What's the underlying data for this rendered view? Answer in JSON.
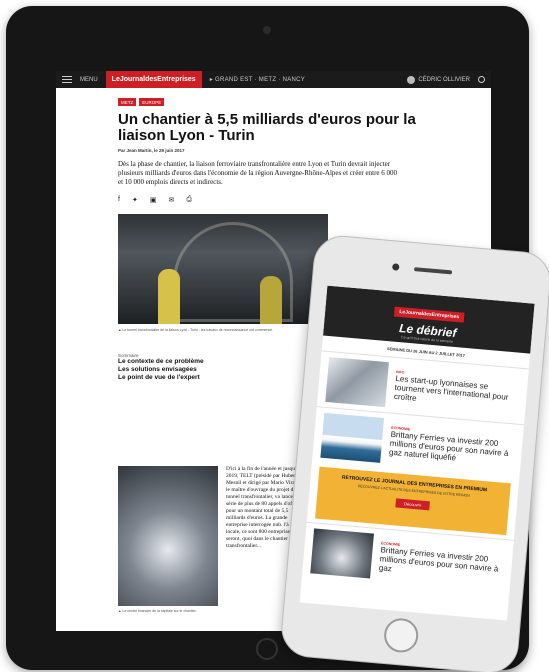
{
  "tablet": {
    "nav": {
      "menu_label": "MENU",
      "logo": "LeJournaldesEntreprises",
      "region": "▸ GRAND EST · METZ · NANCY",
      "user": "CÉDRIC OLLIVIER"
    },
    "article": {
      "tags": [
        "METZ",
        "EUROPE"
      ],
      "title": "Un chantier à 5,5 milliards d'euros pour la liaison Lyon - Turin",
      "byline": "Par Jean Martin, le 29 juin 2017",
      "lead": "Dès la phase de chantier, la liaison ferroviaire transfrontalière entre Lyon et Turin devrait injecter plusieurs milliards d'euros dans l'économie de la région Auvergne-Rhône-Alpes et créer entre 6 000 et 10 000 emplois directs et indirects.",
      "photo_caption": "▲ Le tunnel transfrontalier de la liaison Lyon - Turin : les travaux de reconnaissance ont commencé.",
      "summary_label": "Sommaire",
      "summary": [
        "Le contexte de ce problème",
        "Les solutions envisagées",
        "Le point de vue de l'expert"
      ],
      "photo2_caption": "▲ Le centre financier de la capitale sur le chantier.",
      "body_text": "D'ici à la fin de l'année et jusqu'en 2019, TELT (présidé par Hubert Du Mesnil et dirigé par Mario Virano), le maître d'ouvrage du projet de tunnel transfrontalier, va lancer une série de plus de 80 appels d'offres pour un montant total de 5,5 milliards d'euros. La grande entreprise interrogée nub. l'à PME locale, ce sont 800 entreprises qui seront, quoi dans le chantier du transfrontalier..."
    }
  },
  "phone": {
    "logo": "LeJournaldesEntreprises",
    "title": "Le débrief",
    "subtitle": "Ce qu'il faut retenir de la semaine",
    "date": "SEMAINE DU 26 JUIN AU 2 JUILLET 2017",
    "items": [
      {
        "tag": "INFO",
        "text": "Les start-up lyonnaises se tournent vers l'international pour croître"
      },
      {
        "tag": "ÉCONOMIE",
        "text": "Brittany Ferries va investir 200 millions d'euros pour son navire à gaz naturel liquéfié"
      },
      {
        "tag": "ÉCONOMIE",
        "text": "Brittany Ferries va investir 200 millions d'euros pour son navire à gaz"
      }
    ],
    "ad": {
      "title": "RETROUVEZ LE JOURNAL DES ENTREPRISES EN PREMIUM",
      "text": "DÉCOUVREZ L'ACTUALITÉ DES ENTREPRISES DE VOTRE RÉGION",
      "button": "Découvrir"
    }
  }
}
